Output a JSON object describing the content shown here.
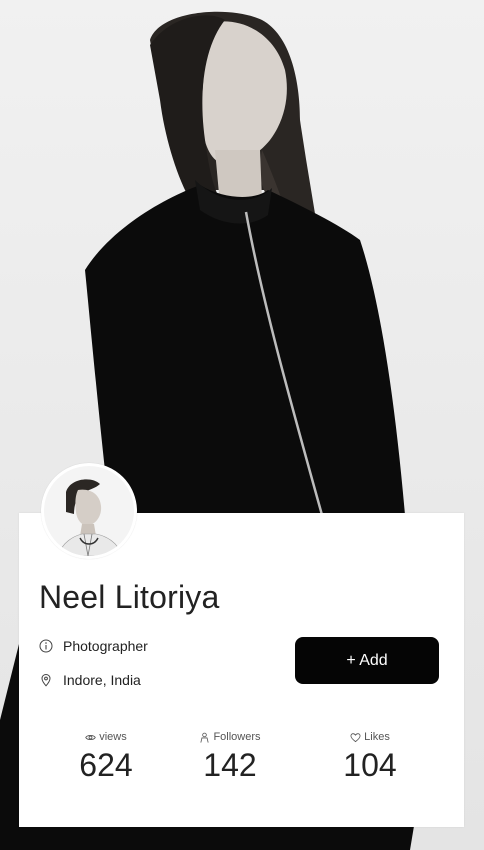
{
  "profile": {
    "name": "Neel Litoriya",
    "profession": "Photographer",
    "location": "Indore, India",
    "add_label": "+ Add"
  },
  "stats": [
    {
      "label": "views",
      "value": "624",
      "icon": "eye-icon"
    },
    {
      "label": "Followers",
      "value": "142",
      "icon": "user-icon"
    },
    {
      "label": "Likes",
      "value": "104",
      "icon": "heart-icon"
    }
  ],
  "colors": {
    "button_bg": "#050505",
    "card_bg": "#ffffff",
    "text": "#222222"
  }
}
